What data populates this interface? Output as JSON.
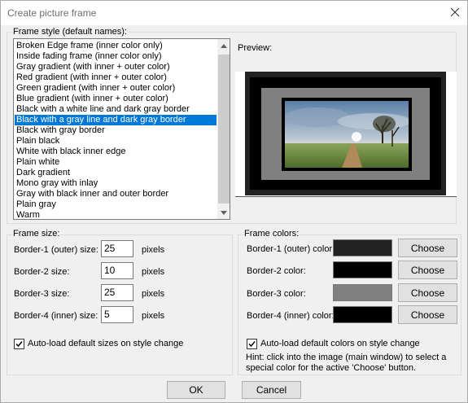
{
  "window": {
    "title": "Create picture frame",
    "close_icon": "close-icon"
  },
  "frame_style": {
    "legend": "Frame style (default names):",
    "items": [
      "Broken Edge frame (inner color only)",
      "Inside fading frame (inner color only)",
      "Gray gradient (with inner + outer color)",
      "Red gradient (with inner + outer color)",
      "Green gradient (with inner + outer color)",
      "Blue gradient (with inner + outer color)",
      "Black with a white line and dark gray border",
      "Black with a gray line and dark gray border",
      "Black with gray border",
      "Plain black",
      "White with black inner edge",
      "Plain white",
      "Dark gradient",
      "Mono gray with inlay",
      "Gray with black inner and outer border",
      "Plain gray",
      "Warm"
    ],
    "selected_index": 7
  },
  "preview": {
    "label": "Preview:"
  },
  "frame_size": {
    "legend": "Frame size:",
    "rows": [
      {
        "label": "Border-1 (outer) size:",
        "value": "25",
        "unit": "pixels"
      },
      {
        "label": "Border-2 size:",
        "value": "10",
        "unit": "pixels"
      },
      {
        "label": "Border-3 size:",
        "value": "25",
        "unit": "pixels"
      },
      {
        "label": "Border-4 (inner) size:",
        "value": "5",
        "unit": "pixels"
      }
    ],
    "autoload_label": "Auto-load default sizes on style change",
    "autoload_checked": true
  },
  "frame_colors": {
    "legend": "Frame colors:",
    "rows": [
      {
        "label": "Border-1 (outer) color:",
        "color": "#222222",
        "button": "Choose"
      },
      {
        "label": "Border-2 color:",
        "color": "#000000",
        "button": "Choose"
      },
      {
        "label": "Border-3 color:",
        "color": "#808080",
        "button": "Choose"
      },
      {
        "label": "Border-4 (inner) color:",
        "color": "#000000",
        "button": "Choose"
      }
    ],
    "autoload_label": "Auto-load default colors on style change",
    "autoload_checked": true,
    "hint": "Hint: click into the image (main window) to select a special color for the active 'Choose' button."
  },
  "buttons": {
    "ok": "OK",
    "cancel": "Cancel"
  },
  "colors": {
    "selection": "#0078d7",
    "dialog_bg": "#f0f0f0",
    "button_bg": "#e1e1e1"
  }
}
